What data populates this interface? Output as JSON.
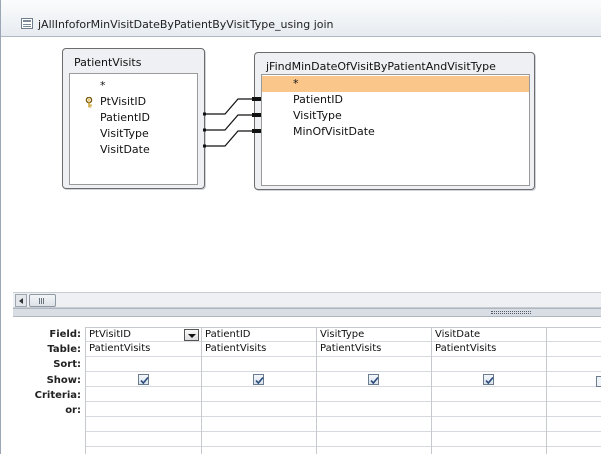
{
  "window": {
    "title": "jAllInfoforMinVisitDateByPatientByVisitType_using join"
  },
  "tables": [
    {
      "title": "PatientVisits",
      "fields": [
        "*",
        "PtVisitID",
        "PatientID",
        "VisitType",
        "VisitDate"
      ],
      "primary_key": "PtVisitID"
    },
    {
      "title": "jFindMinDateOfVisitByPatientAndVisitType",
      "fields": [
        "*",
        "PatientID",
        "VisitType",
        "MinOfVisitDate"
      ],
      "selected_field": "*"
    }
  ],
  "grid": {
    "row_labels": [
      "Field:",
      "Table:",
      "Sort:",
      "Show:",
      "Criteria:",
      "or:"
    ],
    "columns": [
      {
        "field": "PtVisitID",
        "table": "PatientVisits",
        "show": true
      },
      {
        "field": "PatientID",
        "table": "PatientVisits",
        "show": true
      },
      {
        "field": "VisitType",
        "table": "PatientVisits",
        "show": true
      },
      {
        "field": "VisitDate",
        "table": "PatientVisits",
        "show": true
      }
    ]
  },
  "colors": {
    "selected_row": "#fbc68a",
    "table_box_bg": "#eef0f3",
    "check_color": "#2a4a7a"
  },
  "icons": {
    "title": "query-window-icon",
    "primary_key": "key-icon",
    "dropdown": "chevron-down-icon",
    "scroll_left": "arrow-left-icon"
  }
}
